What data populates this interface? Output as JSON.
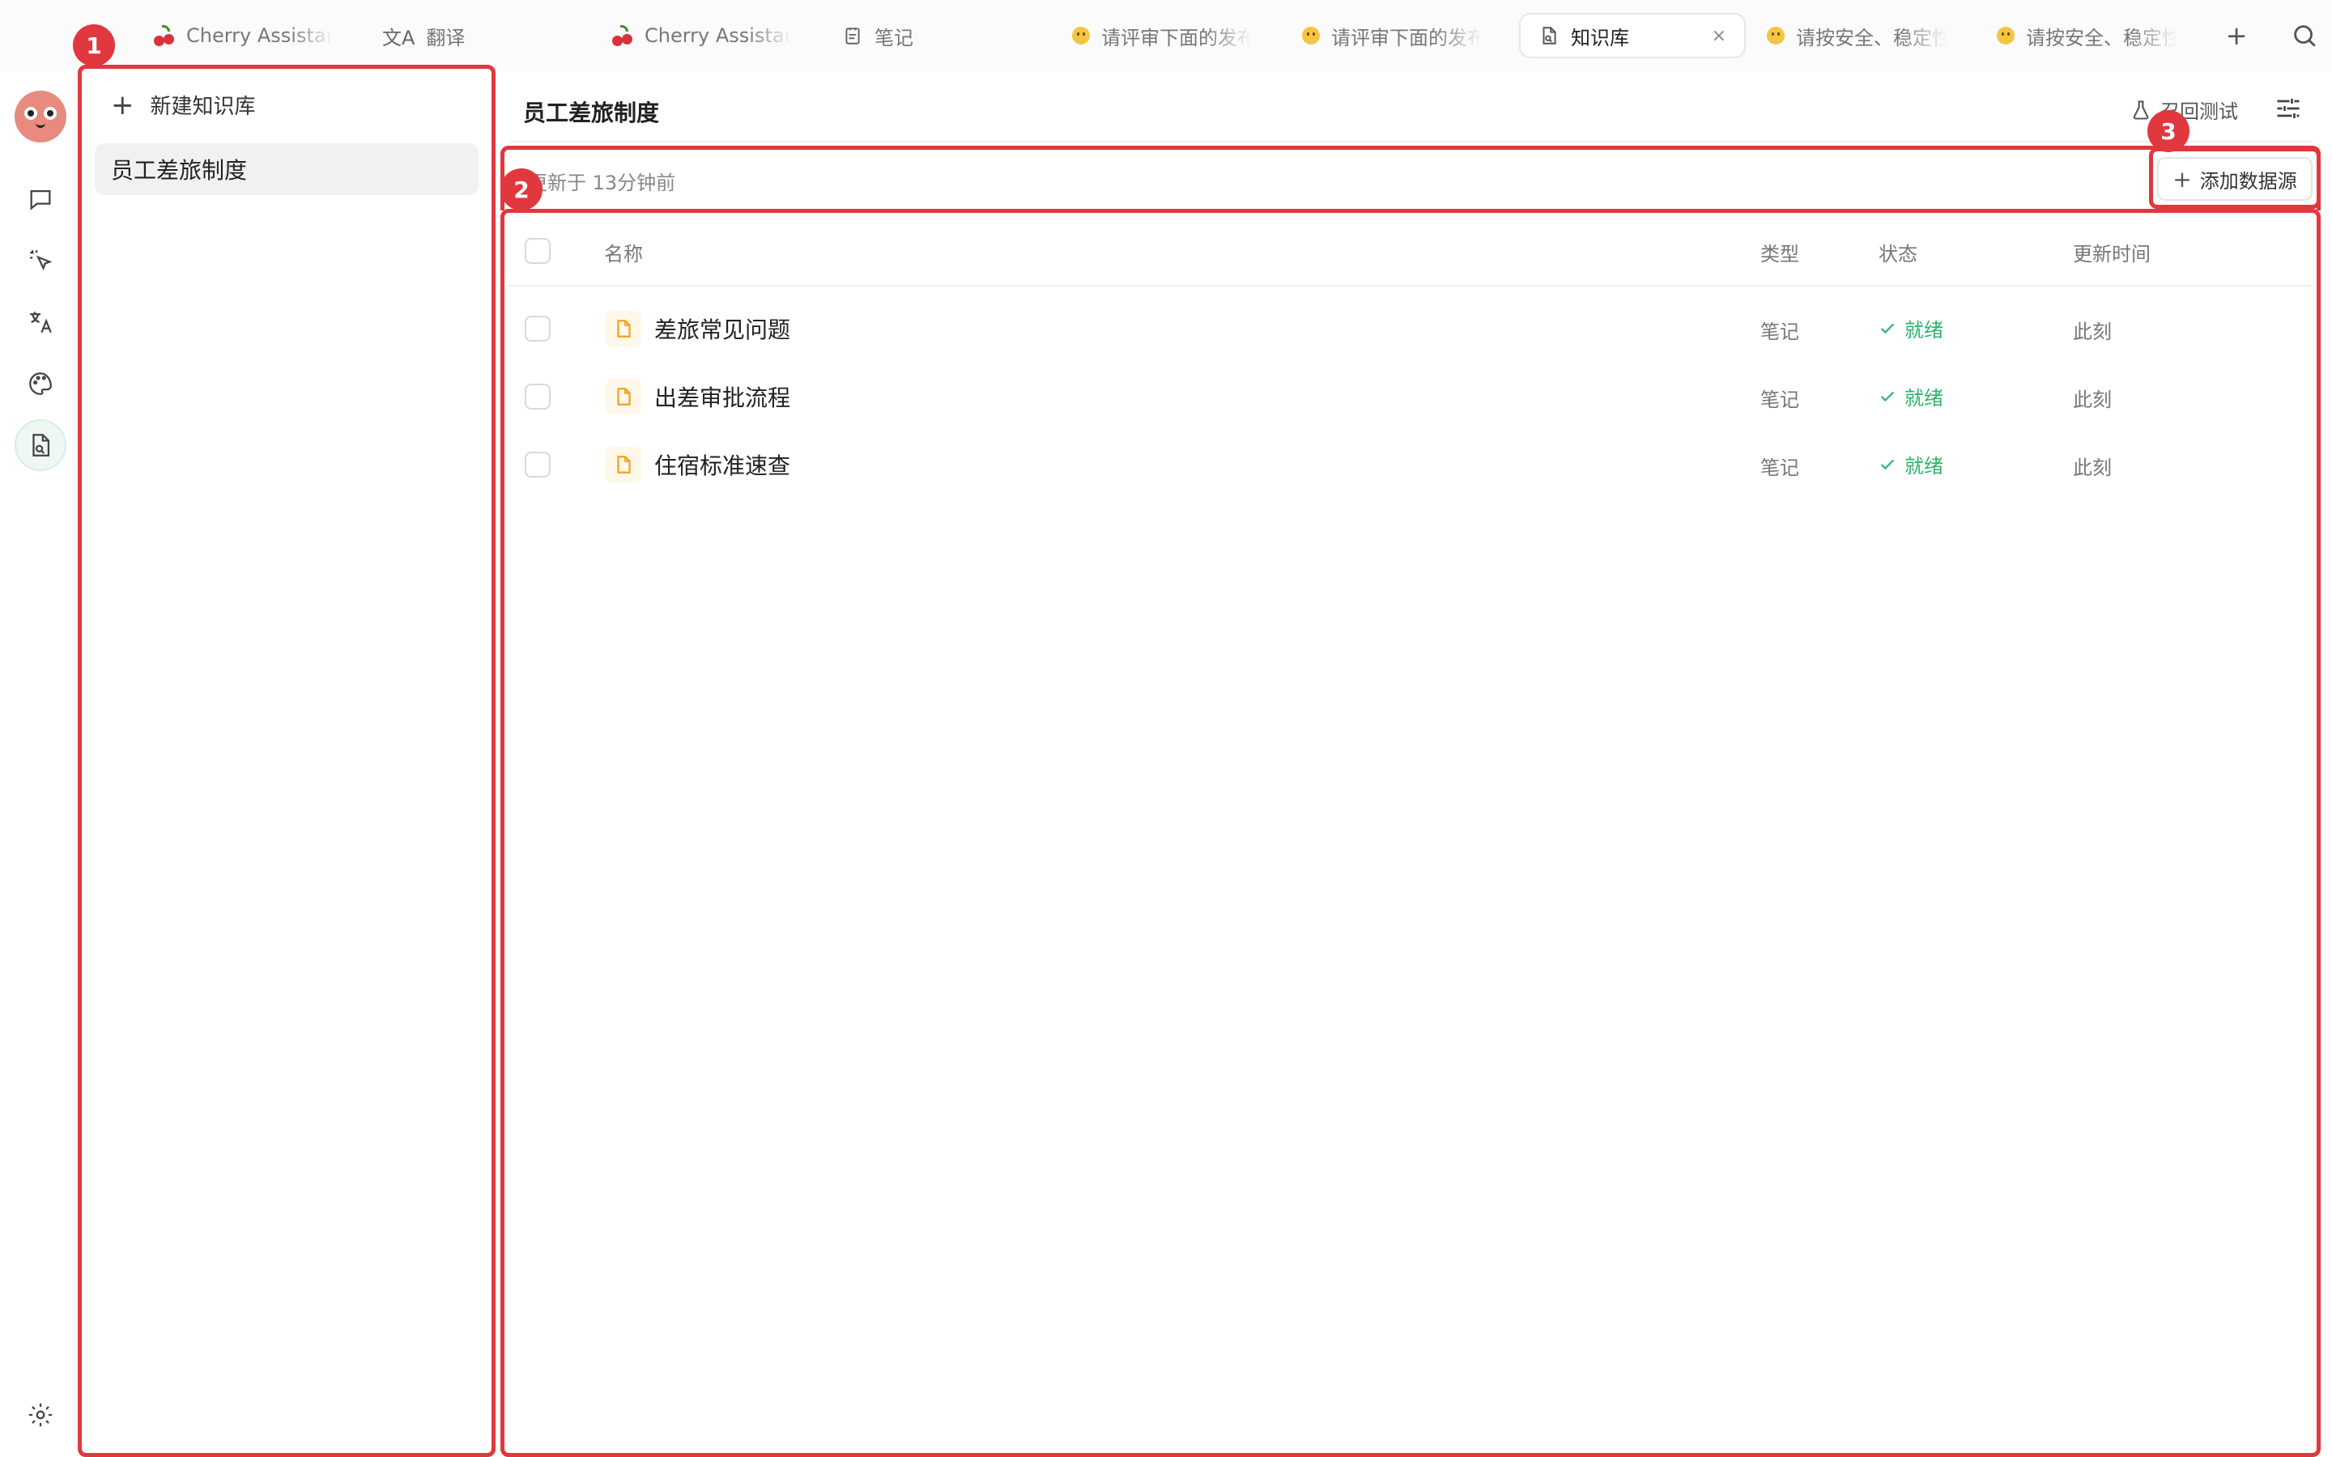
{
  "tabs": [
    {
      "label": "Cherry Assistant",
      "icon": "cherry-icon"
    },
    {
      "label": "翻译",
      "icon": "translate-icon"
    },
    {
      "label": "Cherry Assistant",
      "icon": "cherry-icon"
    },
    {
      "label": "笔记",
      "icon": "note-icon"
    },
    {
      "label": "请评审下面的发布",
      "icon": "emoji-icon"
    },
    {
      "label": "请评审下面的发布",
      "icon": "emoji-icon"
    },
    {
      "label": "知识库",
      "icon": "knowledge-icon",
      "active": true
    },
    {
      "label": "请按安全、稳定性",
      "icon": "emoji-icon"
    },
    {
      "label": "请按安全、稳定性",
      "icon": "emoji-icon"
    }
  ],
  "tabbar": {
    "add": "+",
    "close": "×"
  },
  "kb_list": {
    "new_label": "新建知识库",
    "items": [
      "员工差旅制度"
    ]
  },
  "main": {
    "title": "员工差旅制度",
    "recall_test": "召回测试",
    "updated": "更新于 13分钟前",
    "add_source": "添加数据源",
    "columns": {
      "name": "名称",
      "type": "类型",
      "status": "状态",
      "updated": "更新时间"
    },
    "rows": [
      {
        "name": "差旅常见问题",
        "type": "笔记",
        "status": "就绪",
        "updated": "此刻"
      },
      {
        "name": "出差审批流程",
        "type": "笔记",
        "status": "就绪",
        "updated": "此刻"
      },
      {
        "name": "住宿标准速查",
        "type": "笔记",
        "status": "就绪",
        "updated": "此刻"
      }
    ]
  },
  "markers": [
    "1",
    "2",
    "3"
  ],
  "colors": {
    "accent_red": "#e0383e",
    "status_green": "#2fb36a",
    "file_orange": "#f0a020"
  }
}
